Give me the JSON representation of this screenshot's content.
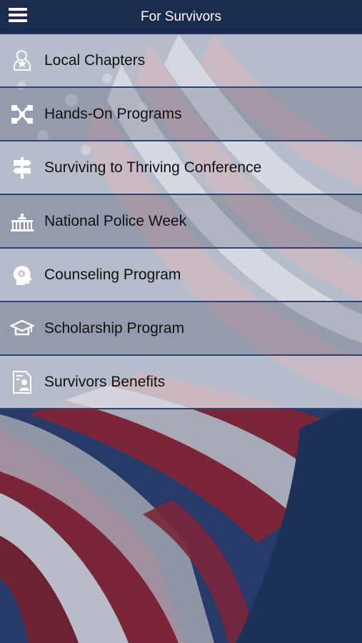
{
  "header": {
    "title": "For Survivors",
    "menu_icon": "hamburger-menu-icon"
  },
  "menu": {
    "items": [
      {
        "label": "Local Chapters",
        "icon": "local-chapters-icon"
      },
      {
        "label": "Hands-On Programs",
        "icon": "hands-on-programs-icon"
      },
      {
        "label": "Surviving to Thriving Conference",
        "icon": "signpost-icon"
      },
      {
        "label": "National Police Week",
        "icon": "capitol-building-icon"
      },
      {
        "label": "Counseling Program",
        "icon": "head-gears-icon"
      },
      {
        "label": "Scholarship Program",
        "icon": "graduation-cap-icon"
      },
      {
        "label": "Survivors Benefits",
        "icon": "document-person-icon"
      }
    ]
  },
  "colors": {
    "header_bg": "#1b2b4f",
    "navy": "#1c2f55",
    "flag_red": "#7a2638",
    "flag_white": "#c9ccd4"
  }
}
